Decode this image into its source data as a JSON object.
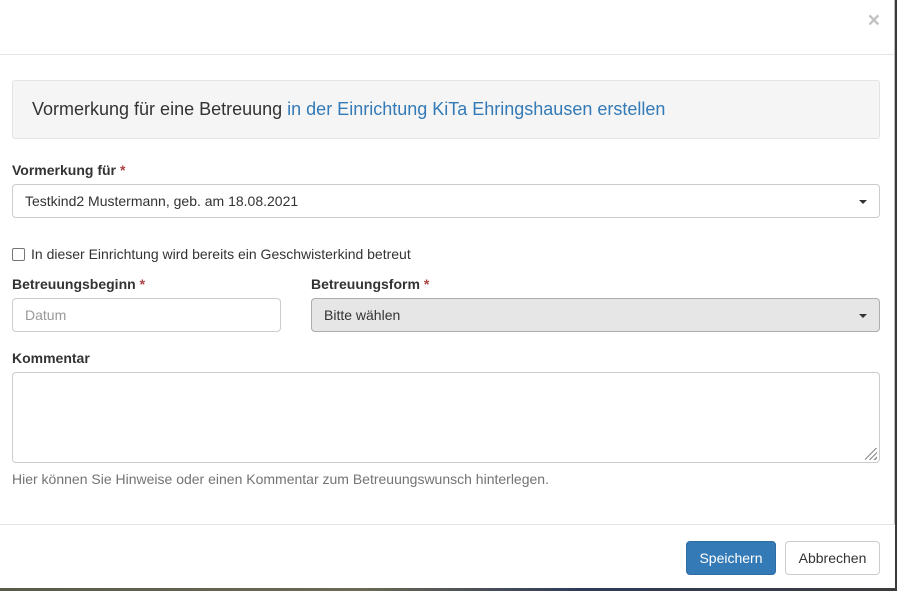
{
  "header": {
    "close_label": "×"
  },
  "well": {
    "text_plain": "Vormerkung für eine Betreuung",
    "text_link": "in der Einrichtung KiTa Ehringshausen erstellen"
  },
  "fields": {
    "vormerkung_label": "Vormerkung für",
    "required_mark": "*",
    "vormerkung_value": "Testkind2 Mustermann, geb. am 18.08.2021",
    "sibling_checkbox_label": "In dieser Einrichtung wird bereits ein Geschwisterkind betreut",
    "sibling_checked": false,
    "beginn_label": "Betreuungsbeginn",
    "beginn_placeholder": "Datum",
    "form_label": "Betreuungsform",
    "form_value": "Bitte wählen",
    "kommentar_label": "Kommentar",
    "kommentar_help": "Hier können Sie Hinweise oder einen Kommentar zum Betreuungswunsch hinterlegen."
  },
  "footer": {
    "save_label": "Speichern",
    "cancel_label": "Abbrechen"
  },
  "colors": {
    "primary": "#337ab7",
    "link": "#337ab7",
    "required": "#a94442"
  }
}
